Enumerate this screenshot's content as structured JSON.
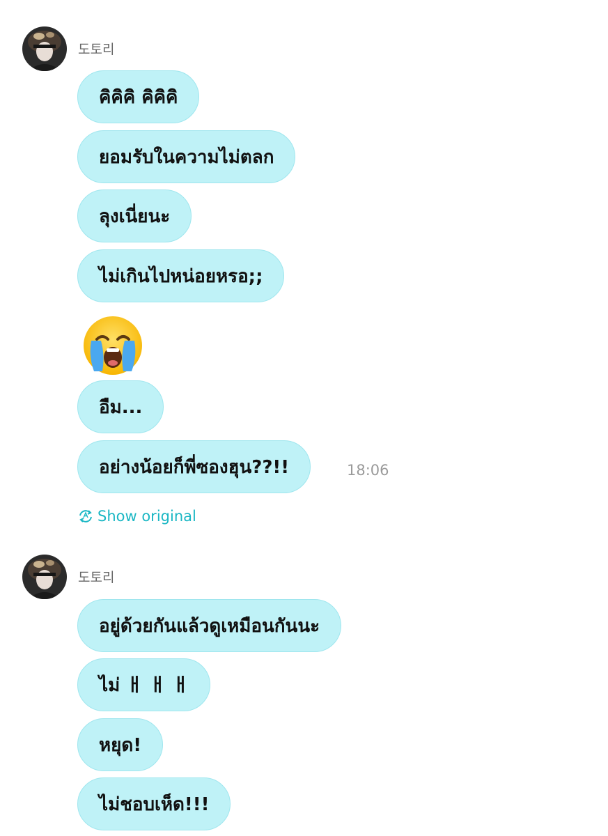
{
  "groups": [
    {
      "sender": "도토리",
      "messages": [
        "คิคิคิ คิคิคิ",
        "ยอมรับในความไม่ตลก",
        "ลุงเนี่ยนะ",
        "ไม่เกินไปหน่อยหรอ;;",
        "อืม...",
        "อย่างน้อยก็พี่ซองฮุน??!!"
      ],
      "emoji": "😭",
      "emoji_name": "loudly-crying-face",
      "timestamp": "18:06",
      "show_original_label": "Show original"
    },
    {
      "sender": "도토리",
      "messages": [
        "อยู่ด้วยกันแล้วดูเหมือนกันนะ",
        "ไม่ ㅐ ㅐ ㅐ",
        "หยุด!",
        "ไม่ชอบเห็ด!!!"
      ]
    }
  ],
  "colors": {
    "bubble": "#bff2f7",
    "bubble_border": "#9fe6ee",
    "link": "#1bb7c4",
    "timestamp": "#9a9a9a"
  }
}
